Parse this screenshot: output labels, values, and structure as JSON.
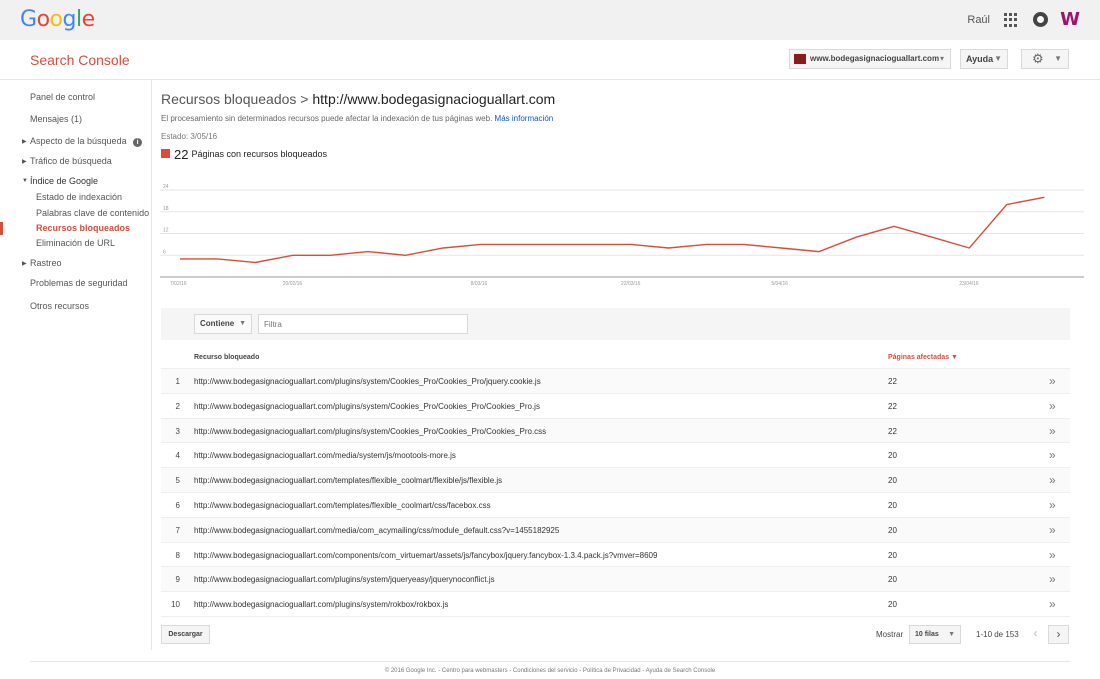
{
  "topbar": {
    "logo": "Google",
    "user_name": "Raúl",
    "brand_glyph": "W",
    "icons": [
      "apps-icon",
      "notifications-icon",
      "brand-icon"
    ]
  },
  "header": {
    "product": "Search Console",
    "site": "www.bodegasignacioguallart.com",
    "help_label": "Ayuda",
    "settings_icon": "gear-icon"
  },
  "sidebar": {
    "items": [
      {
        "label": "Panel de control"
      },
      {
        "label": "Mensajes (1)"
      },
      {
        "label": "Aspecto de la búsqueda"
      },
      {
        "label": "Tráfico de búsqueda"
      },
      {
        "label": "Índice de Google"
      },
      {
        "label": "Estado de indexación"
      },
      {
        "label": "Palabras clave de contenido"
      },
      {
        "label": "Recursos bloqueados"
      },
      {
        "label": "Eliminación de URL"
      },
      {
        "label": "Rastreo"
      },
      {
        "label": "Problemas de seguridad"
      },
      {
        "label": "Otros recursos"
      }
    ]
  },
  "main": {
    "title_prefix": "Recursos bloqueados > ",
    "title_url": "http://www.bodegasignacioguallart.com",
    "description": "El procesamiento sin determinados recursos puede afectar la indexación de tus páginas web.",
    "more_info": "Más información",
    "status": "Estado: 3/05/16",
    "legend_count": "22",
    "legend_label": "Páginas con recursos bloqueados"
  },
  "chart_data": {
    "type": "line",
    "x": [
      "7/02/16",
      "14/02/16",
      "17/02/16",
      "20/02/16",
      "24/02/16",
      "27/02/16",
      "1/03/16",
      "4/03/16",
      "8/03/16",
      "11/03/16",
      "15/03/16",
      "18/03/16",
      "22/03/16",
      "25/03/16",
      "29/03/16",
      "1/04/16",
      "5/04/16",
      "8/04/16",
      "12/04/16",
      "15/04/16",
      "19/04/16",
      "23/04/16",
      "26/04/16",
      "29/04/16",
      "3/05/16"
    ],
    "x_tick_labels": [
      "7/02/16",
      "20/02/16",
      "8/03/16",
      "22/03/16",
      "5/04/16",
      "23/04/16"
    ],
    "series": [
      {
        "name": "Páginas con recursos bloqueados",
        "values": [
          5,
          5,
          4,
          6,
          6,
          7,
          6,
          8,
          9,
          9,
          9,
          9,
          9,
          8,
          9,
          9,
          8,
          7,
          11,
          14,
          11,
          8,
          20,
          22
        ]
      }
    ],
    "y_ticks": [
      6,
      12,
      18,
      24
    ],
    "ylim": [
      0,
      24
    ],
    "color": "#dd4b39",
    "grid": true
  },
  "filter": {
    "mode": "Contiene",
    "placeholder": "Filtra"
  },
  "table": {
    "col_resource": "Recurso bloqueado",
    "col_pages": "Páginas afectadas",
    "rows": [
      {
        "num": "1",
        "url": "http://www.bodegasignacioguallart.com/plugins/system/Cookies_Pro/Cookies_Pro/jquery.cookie.js",
        "pages": "22"
      },
      {
        "num": "2",
        "url": "http://www.bodegasignacioguallart.com/plugins/system/Cookies_Pro/Cookies_Pro/Cookies_Pro.js",
        "pages": "22"
      },
      {
        "num": "3",
        "url": "http://www.bodegasignacioguallart.com/plugins/system/Cookies_Pro/Cookies_Pro/Cookies_Pro.css",
        "pages": "22"
      },
      {
        "num": "4",
        "url": "http://www.bodegasignacioguallart.com/media/system/js/mootools-more.js",
        "pages": "20"
      },
      {
        "num": "5",
        "url": "http://www.bodegasignacioguallart.com/templates/flexible_coolmart/flexible/js/flexible.js",
        "pages": "20"
      },
      {
        "num": "6",
        "url": "http://www.bodegasignacioguallart.com/templates/flexible_coolmart/css/facebox.css",
        "pages": "20"
      },
      {
        "num": "7",
        "url": "http://www.bodegasignacioguallart.com/media/com_acymailing/css/module_default.css?v=1455182925",
        "pages": "20"
      },
      {
        "num": "8",
        "url": "http://www.bodegasignacioguallart.com/components/com_virtuemart/assets/js/fancybox/jquery.fancybox-1.3.4.pack.js?vmver=8609",
        "pages": "20"
      },
      {
        "num": "9",
        "url": "http://www.bodegasignacioguallart.com/plugins/system/jqueryeasy/jquerynoconflict.js",
        "pages": "20"
      },
      {
        "num": "10",
        "url": "http://www.bodegasignacioguallart.com/plugins/system/rokbox/rokbox.js",
        "pages": "20"
      }
    ]
  },
  "pagination": {
    "download_label": "Descargar",
    "show_label": "Mostrar",
    "rows_option": "10 filas",
    "range": "1-10 de 153"
  },
  "footer": {
    "text": "© 2016 Google Inc. - Centro para webmasters - Condiciones del servicio - Política de Privacidad - Ayuda de Search Console"
  }
}
